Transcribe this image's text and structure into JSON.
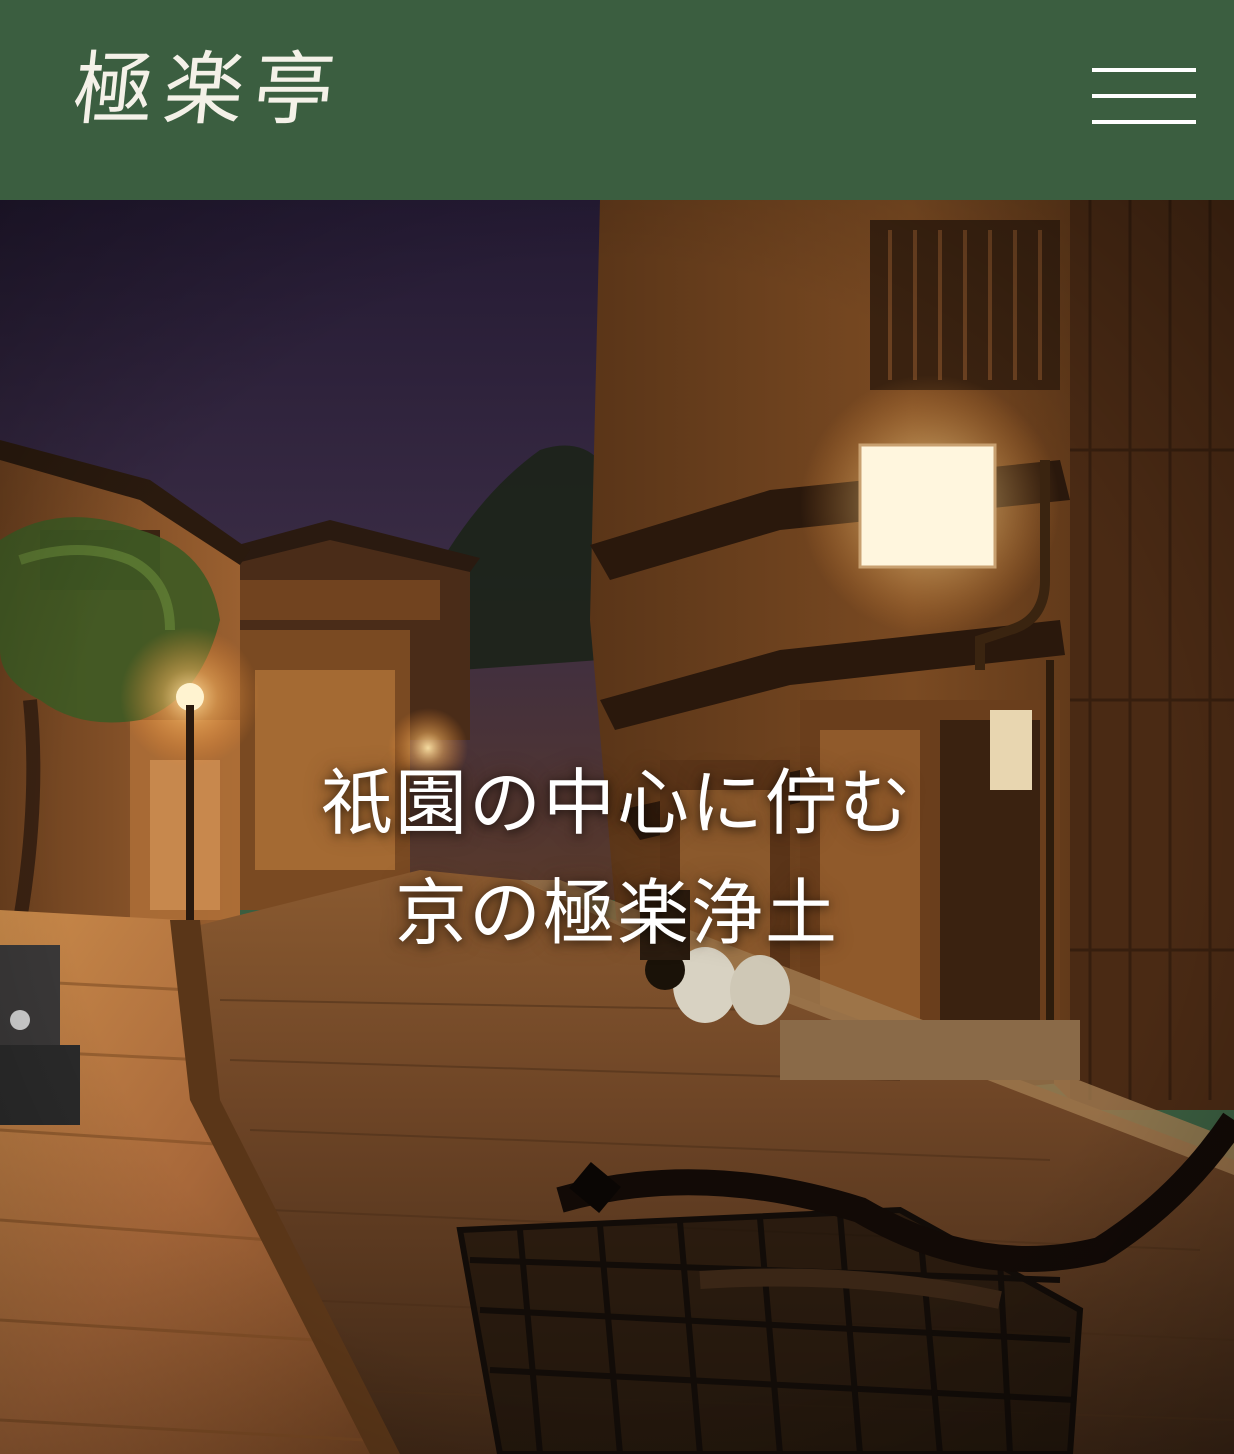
{
  "header": {
    "logo_text": "極楽亭",
    "menu_icon": "hamburger-menu-icon",
    "background_color": "#3b5e40"
  },
  "hero": {
    "image_subject": "kyoto-night-street-photo",
    "headline_line1": "祇園の中心に佇む",
    "headline_line2": "京の極楽浄土"
  }
}
